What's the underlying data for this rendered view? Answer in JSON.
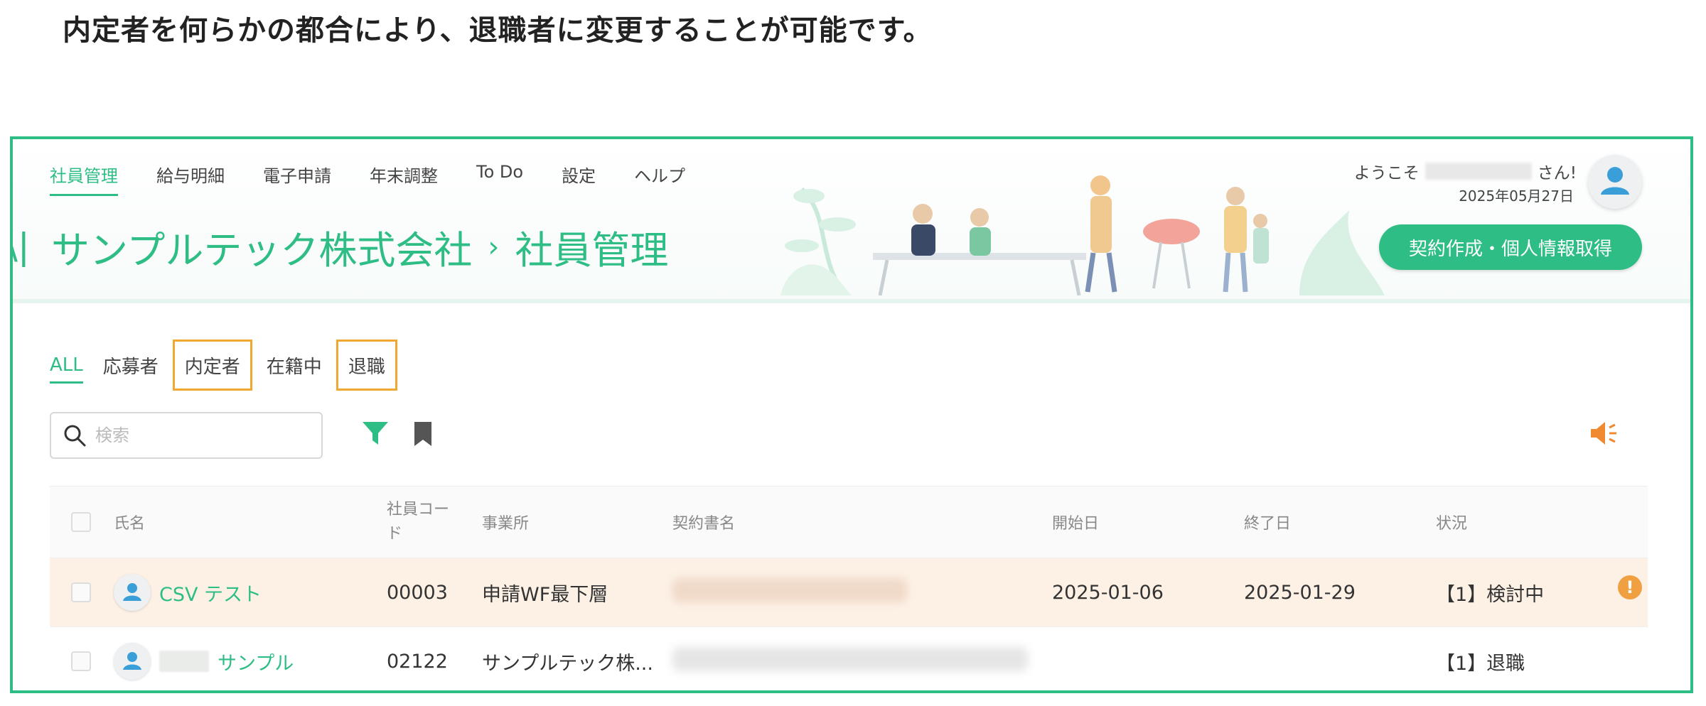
{
  "instruction": "内定者を何らかの都合により、退職者に変更することが可能です。",
  "nav": {
    "items": [
      "社員管理",
      "給与明細",
      "電子申請",
      "年末調整",
      "To Do",
      "設定",
      "ヘルプ"
    ],
    "active_index": 0
  },
  "header": {
    "welcome_prefix": "ようこそ",
    "welcome_suffix": "さん!",
    "date": "2025年05月27日",
    "company": "サンプルテック株式会社",
    "separator": "›",
    "section": "社員管理",
    "contract_button": "契約作成・個人情報取得"
  },
  "tabs": [
    "ALL",
    "応募者",
    "内定者",
    "在籍中",
    "退職"
  ],
  "search": {
    "placeholder": "検索"
  },
  "table": {
    "headers": {
      "name": "氏名",
      "code_line1": "社員コー",
      "code_line2": "ド",
      "office": "事業所",
      "contract": "契約書名",
      "start": "開始日",
      "end": "終了日",
      "status": "状況"
    },
    "rows": [
      {
        "name": "CSV テスト",
        "code": "00003",
        "office": "申請WF最下層",
        "start": "2025-01-06",
        "end": "2025-01-29",
        "status": "【1】検討中",
        "alert": "!"
      },
      {
        "name": "サンプル",
        "code": "02122",
        "office": "サンプルテック株...",
        "start": "",
        "end": "",
        "status": "【1】退職"
      }
    ]
  },
  "colors": {
    "accent": "#2ebd85",
    "highlight_border": "#f0a830",
    "row_highlight": "#fdf1e6",
    "warning": "#f0a040"
  }
}
